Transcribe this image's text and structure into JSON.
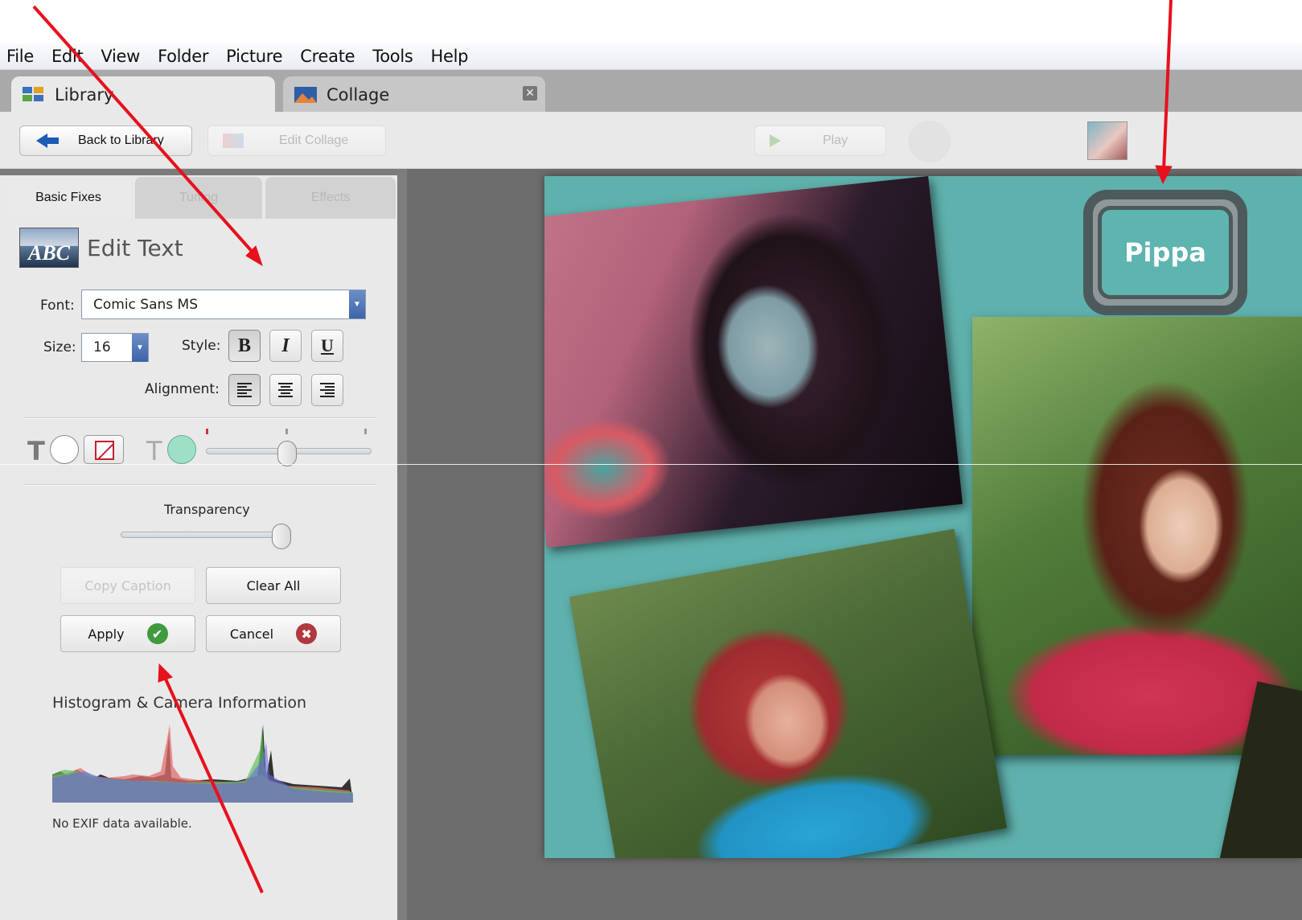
{
  "menu": [
    "File",
    "Edit",
    "View",
    "Folder",
    "Picture",
    "Create",
    "Tools",
    "Help"
  ],
  "tabs": {
    "library": "Library",
    "collage": "Collage",
    "close": "✕"
  },
  "toolbar": {
    "back": "Back to Library",
    "edit_collage": "Edit Collage",
    "play": "Play"
  },
  "panel": {
    "tabs": [
      "Basic Fixes",
      "Tuning",
      "Effects"
    ],
    "section_title": "Edit Text",
    "abc_icon_text": "ABC",
    "font_label": "Font:",
    "font_value": "Comic Sans MS",
    "size_label": "Size:",
    "size_value": "16",
    "style_label": "Style:",
    "bold": "B",
    "italic": "I",
    "underline": "U",
    "alignment_label": "Alignment:",
    "text_color_glyph": "T",
    "bg_color_glyph": "T",
    "transparency_label": "Transparency",
    "transparency_value": 1.0,
    "copy_caption": "Copy Caption",
    "clear_all": "Clear All",
    "apply": "Apply",
    "cancel": "Cancel",
    "apply_glyph": "✔",
    "cancel_glyph": "✖",
    "histogram_title": "Histogram & Camera Information",
    "exif": "No EXIF data available."
  },
  "collage": {
    "name_tag": "Pippa"
  },
  "colors": {
    "accent_blue": "#1d5bb5",
    "collage_bg": "#5fb1ad",
    "annotation": "#e8101c"
  }
}
